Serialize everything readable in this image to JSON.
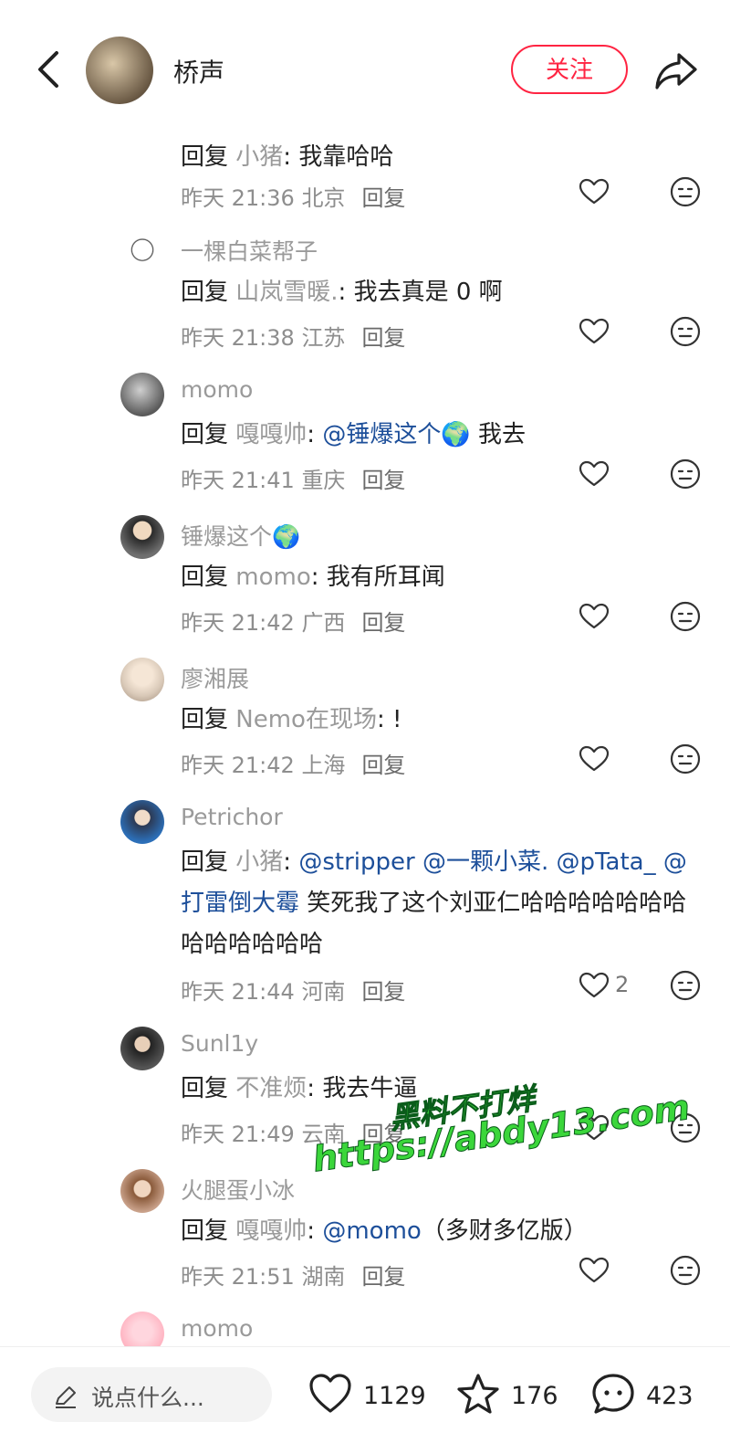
{
  "header": {
    "author_name": "桥声",
    "follow_label": "关注"
  },
  "comments": [
    {
      "user": "",
      "reply_word": "回复",
      "reply_target": "小猪",
      "colon": ": ",
      "mention": "",
      "text": "我靠哈哈",
      "time": "昨天 21:36",
      "region": "北京",
      "reply_label": "回复",
      "likes": ""
    },
    {
      "user": "一棵白菜帮子",
      "reply_word": "回复",
      "reply_target": "山岚雪暖.",
      "colon": ": ",
      "mention": "",
      "text": "我去真是 0 啊",
      "time": "昨天 21:38",
      "region": "江苏",
      "reply_label": "回复",
      "likes": ""
    },
    {
      "user": "momo",
      "reply_word": "回复",
      "reply_target": "嘎嘎帅",
      "colon": ": ",
      "mention": "@锤爆这个🌍",
      "text": " 我去",
      "time": "昨天 21:41",
      "region": "重庆",
      "reply_label": "回复",
      "likes": ""
    },
    {
      "user": "锤爆这个🌍",
      "reply_word": "回复",
      "reply_target": "momo",
      "colon": ": ",
      "mention": "",
      "text": "我有所耳闻",
      "time": "昨天 21:42",
      "region": "广西",
      "reply_label": "回复",
      "likes": ""
    },
    {
      "user": "廖湘展",
      "reply_word": "回复",
      "reply_target": "Nemo在现场",
      "colon": ": ",
      "mention": "",
      "text": "!",
      "time": "昨天 21:42",
      "region": "上海",
      "reply_label": "回复",
      "likes": ""
    },
    {
      "user": "Petrichor",
      "reply_word": "回复",
      "reply_target": "小猪",
      "colon": ": ",
      "mention": "@stripper @一颗小菜. @pTata_ @打雷倒大霉",
      "text": " 笑死我了这个刘亚仁哈哈哈哈哈哈哈哈哈哈哈哈哈",
      "time": "昨天 21:44",
      "region": "河南",
      "reply_label": "回复",
      "likes": "2"
    },
    {
      "user": "Sunl1y",
      "reply_word": "回复",
      "reply_target": "不准烦",
      "colon": ": ",
      "mention": "",
      "text": "我去牛逼",
      "time": "昨天 21:49",
      "region": "云南",
      "reply_label": "回复",
      "likes": ""
    },
    {
      "user": "火腿蛋小冰",
      "reply_word": "回复",
      "reply_target": "嘎嘎帅",
      "colon": ": ",
      "mention": "@momo",
      "text": "（多财多亿版）",
      "time": "昨天 21:51",
      "region": "湖南",
      "reply_label": "回复",
      "likes": ""
    },
    {
      "user": "momo",
      "reply_word": "",
      "reply_target": "",
      "colon": "",
      "mention": "",
      "text": "",
      "time": "",
      "region": "",
      "reply_label": "",
      "likes": ""
    }
  ],
  "footer": {
    "input_placeholder": "说点什么...",
    "like_count": "1129",
    "collect_count": "176",
    "comment_count": "423"
  },
  "watermark": {
    "line1": "黑料不打烊",
    "line2": "https://abdy13.com"
  },
  "colors": {
    "accent_red": "#ff2442",
    "mention_blue": "#1d4f9a",
    "watermark_green": "#3bd63b"
  }
}
